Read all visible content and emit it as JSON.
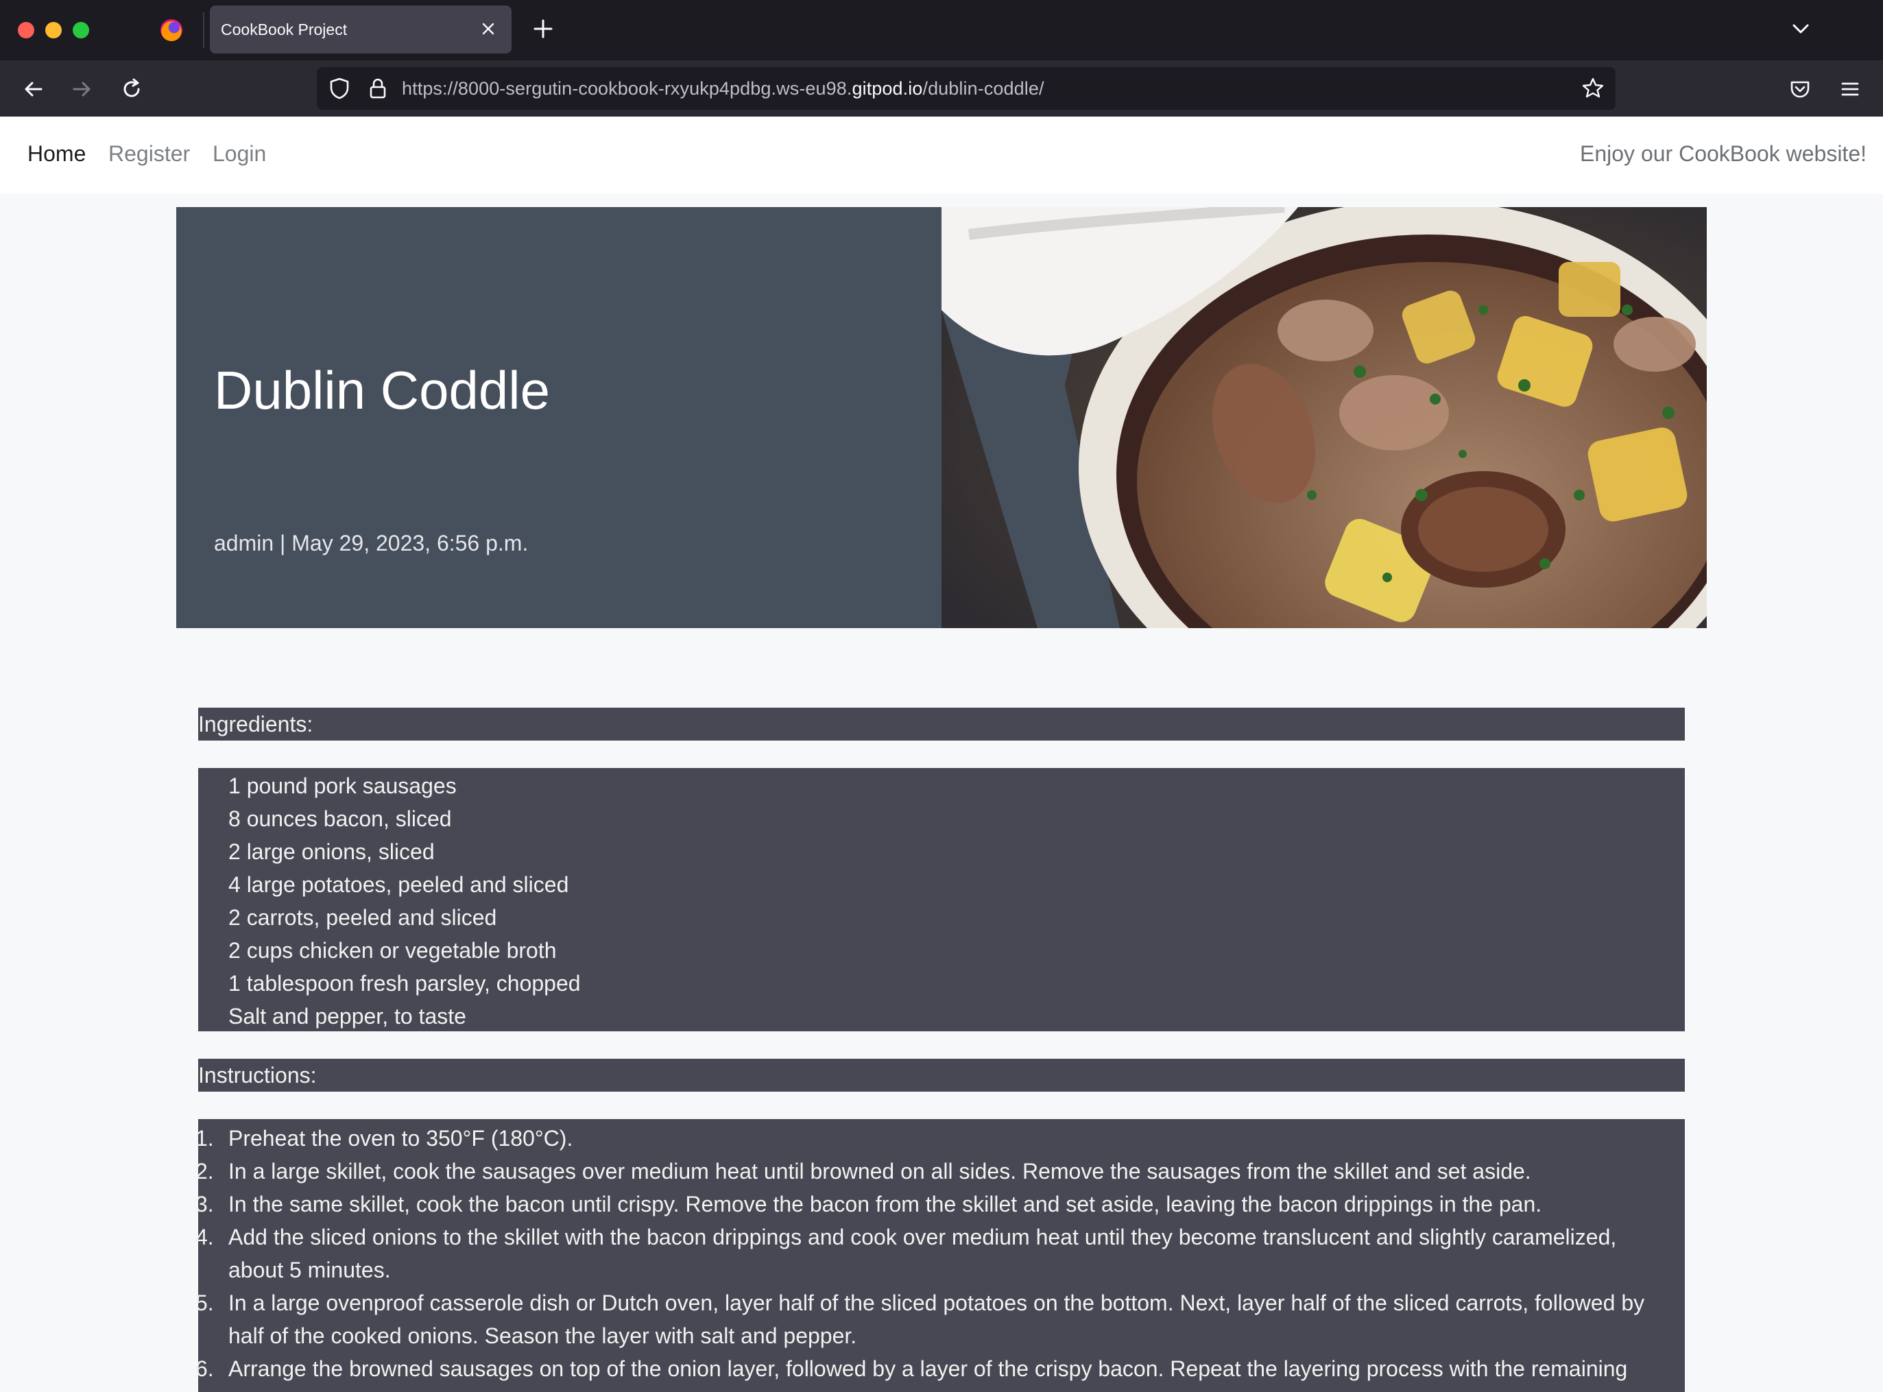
{
  "browser": {
    "tab_title": "CookBook Project",
    "url_prefix": "https://8000-sergutin-cookbook-rxyukp4pdbg.ws-eu98.",
    "url_domain": "gitpod.io",
    "url_path": "/dublin-coddle/"
  },
  "site_nav": {
    "home": "Home",
    "register": "Register",
    "login": "Login",
    "tagline": "Enjoy our CookBook website!"
  },
  "hero": {
    "title": "Dublin Coddle",
    "meta": "admin | May 29, 2023, 6:56 p.m."
  },
  "ingredients": {
    "heading": "Ingredients:",
    "items": [
      "1 pound pork sausages",
      "8 ounces bacon, sliced",
      "2 large onions, sliced",
      "4 large potatoes, peeled and sliced",
      "2 carrots, peeled and sliced",
      "2 cups chicken or vegetable broth",
      "1 tablespoon fresh parsley, chopped",
      "Salt and pepper, to taste"
    ]
  },
  "instructions": {
    "heading": "Instructions:",
    "steps": [
      {
        "num": "1.",
        "text": "Preheat the oven to 350°F (180°C)."
      },
      {
        "num": "2.",
        "text": "In a large skillet, cook the sausages over medium heat until browned on all sides. Remove the sausages from the skillet and set aside."
      },
      {
        "num": "3.",
        "text": "In the same skillet, cook the bacon until crispy. Remove the bacon from the skillet and set aside, leaving the bacon drippings in the pan."
      },
      {
        "num": "4.",
        "text": "Add the sliced onions to the skillet with the bacon drippings and cook over medium heat until they become translucent and slightly caramelized, about 5 minutes."
      },
      {
        "num": "5.",
        "text": "In a large ovenproof casserole dish or Dutch oven, layer half of the sliced potatoes on the bottom. Next, layer half of the sliced carrots, followed by half of the cooked onions. Season the layer with salt and pepper."
      },
      {
        "num": "6.",
        "text": "Arrange the browned sausages on top of the onion layer, followed by a layer of the crispy bacon. Repeat the layering process with the remaining"
      }
    ]
  },
  "colors": {
    "hero_bg": "#464f5c",
    "box_bg": "#474853",
    "page_bg": "#f7f8f9"
  }
}
